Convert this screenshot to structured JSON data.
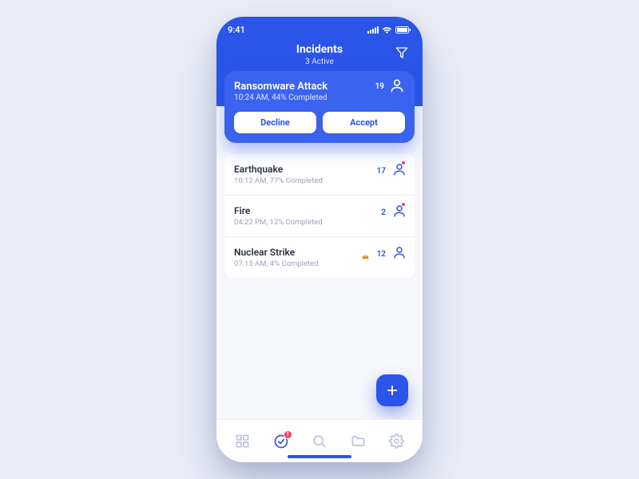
{
  "status": {
    "time": "9:41"
  },
  "header": {
    "title": "Incidents",
    "subtitle": "3 Active"
  },
  "featured": {
    "title": "Ransomware Attack",
    "subtitle": "10:24 AM, 44% Completed",
    "count": "19",
    "decline": "Decline",
    "accept": "Accept"
  },
  "incidents": [
    {
      "title": "Earthquake",
      "subtitle": "10:12 AM, 77% Completed",
      "count": "17",
      "alert": true,
      "crown": false
    },
    {
      "title": "Fire",
      "subtitle": "04:22 PM, 12% Completed",
      "count": "2",
      "alert": true,
      "crown": false
    },
    {
      "title": "Nuclear Strike",
      "subtitle": "07:15 AM, 4% Completed",
      "count": "12",
      "alert": false,
      "crown": true
    }
  ],
  "tabbar": {
    "badge": "1"
  }
}
